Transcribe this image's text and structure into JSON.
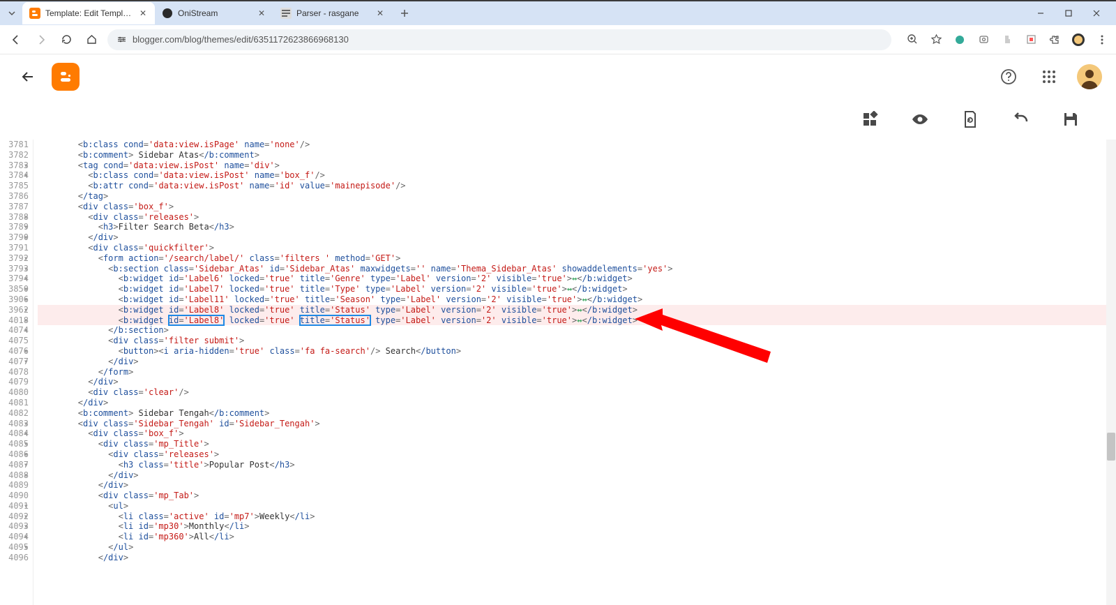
{
  "browser": {
    "tabs": [
      {
        "title": "Template: Edit Template",
        "favicon": "blogger"
      },
      {
        "title": "OniStream",
        "favicon": "dark"
      },
      {
        "title": "Parser - rasgane",
        "favicon": "parser"
      }
    ],
    "url": "blogger.com/blog/themes/edit/6351172623866968130"
  },
  "editor": {
    "lines": [
      {
        "n": "3781",
        "indent": 8,
        "html": "<b:class cond='data:view.isPage' name='none'/>"
      },
      {
        "n": "3782 ▾",
        "indent": 8,
        "html": "<b:comment> Sidebar Atas</b:comment>"
      },
      {
        "n": "3783 ▾",
        "indent": 8,
        "html": "<tag cond='data:view.isPost' name='div'>"
      },
      {
        "n": "3784",
        "indent": 10,
        "html": "<b:class cond='data:view.isPost' name='box_f'/>"
      },
      {
        "n": "3785",
        "indent": 10,
        "html": "<b:attr cond='data:view.isPost' name='id' value='mainepisode'/>"
      },
      {
        "n": "3786",
        "indent": 8,
        "html": "</tag>"
      },
      {
        "n": "3787 ▾",
        "indent": 8,
        "html": "<div class='box_f'>"
      },
      {
        "n": "3788 ▾",
        "indent": 10,
        "html": "<div class='releases'>"
      },
      {
        "n": "3789 ▾",
        "indent": 12,
        "html": "<h3>Filter Search Beta</h3>"
      },
      {
        "n": "3790",
        "indent": 10,
        "html": "</div>"
      },
      {
        "n": "3791 ▾",
        "indent": 10,
        "html": "<div class='quickfilter'>"
      },
      {
        "n": "3792 ▾",
        "indent": 12,
        "html": "<form action='/search/label/' class='filters ' method='GET'>"
      },
      {
        "n": "3793 ▾",
        "indent": 14,
        "html": "<b:section class='Sidebar_Atas' id='Sidebar_Atas' maxwidgets='' name='Thema_Sidebar_Atas' showaddelements='yes'>"
      },
      {
        "n": "3794 ▾",
        "indent": 16,
        "html": "<b:widget id='Label6' locked='true' title='Genre' type='Label' version='2' visible='true'>↔</b:widget>"
      },
      {
        "n": "3850 ▾",
        "indent": 16,
        "html": "<b:widget id='Label7' locked='true' title='Type' type='Label' version='2' visible='true'>↔</b:widget>"
      },
      {
        "n": "3906 ▾",
        "indent": 16,
        "html": "<b:widget id='Label11' locked='true' title='Season' type='Label' version='2' visible='true'>↔</b:widget>"
      },
      {
        "n": "3962 ▾",
        "indent": 16,
        "pink": true,
        "html": "<b:widget id='Label8' locked='true' title='Status' type='Label' version='2' visible='true'>↔</b:widget>"
      },
      {
        "n": "4018 ▾",
        "indent": 16,
        "pink": true,
        "boxed": true,
        "html": "<b:widget id='Label8' locked='true' title='Status' type='Label' version='2' visible='true'>↔</b:widget>"
      },
      {
        "n": "4074",
        "indent": 14,
        "html": "</b:section>"
      },
      {
        "n": "4075 ▾",
        "indent": 14,
        "html": "<div class='filter submit'>"
      },
      {
        "n": "4076 ▾",
        "indent": 16,
        "html": "<button><i aria-hidden='true' class='fa fa-search'/> Search</button>"
      },
      {
        "n": "4077",
        "indent": 14,
        "html": "</div>"
      },
      {
        "n": "4078",
        "indent": 12,
        "html": "</form>"
      },
      {
        "n": "4079",
        "indent": 10,
        "html": "</div>"
      },
      {
        "n": "4080",
        "indent": 10,
        "html": "<div class='clear'/>"
      },
      {
        "n": "4081",
        "indent": 8,
        "html": "</div>"
      },
      {
        "n": "4082 ▾",
        "indent": 8,
        "html": "<b:comment> Sidebar Tengah</b:comment>"
      },
      {
        "n": "4083 ▾",
        "indent": 8,
        "html": "<div class='Sidebar_Tengah' id='Sidebar_Tengah'>"
      },
      {
        "n": "4084 ▾",
        "indent": 10,
        "html": "<div class='box_f'>"
      },
      {
        "n": "4085 ▾",
        "indent": 12,
        "html": "<div class='mp_Title'>"
      },
      {
        "n": "4086 ▾",
        "indent": 14,
        "html": "<div class='releases'>"
      },
      {
        "n": "4087 ▾",
        "indent": 16,
        "html": "<h3 class='title'>Popular Post</h3>"
      },
      {
        "n": "4088",
        "indent": 14,
        "html": "</div>"
      },
      {
        "n": "4089",
        "indent": 12,
        "html": "</div>"
      },
      {
        "n": "4090 ▾",
        "indent": 12,
        "html": "<div class='mp_Tab'>"
      },
      {
        "n": "4091 ▾",
        "indent": 14,
        "html": "<ul>"
      },
      {
        "n": "4092 ▾",
        "indent": 16,
        "html": "<li class='active' id='mp7'>Weekly</li>"
      },
      {
        "n": "4093 ▾",
        "indent": 16,
        "html": "<li id='mp30'>Monthly</li>"
      },
      {
        "n": "4094 ▾",
        "indent": 16,
        "html": "<li id='mp360'>All</li>"
      },
      {
        "n": "4095",
        "indent": 14,
        "html": "</ul>"
      },
      {
        "n": "4096",
        "indent": 12,
        "html": "</div>"
      }
    ]
  }
}
